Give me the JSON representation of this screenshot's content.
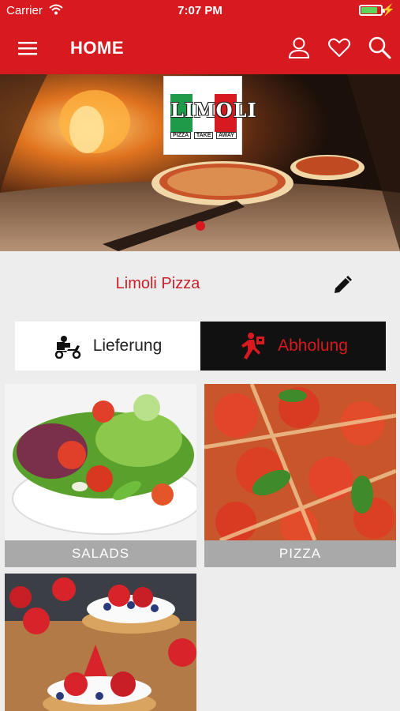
{
  "status_bar": {
    "carrier": "Carrier",
    "time": "7:07 PM"
  },
  "nav": {
    "title": "HOME",
    "icons": [
      "menu-icon",
      "user-icon",
      "heart-icon",
      "search-icon"
    ]
  },
  "hero": {
    "logo": {
      "brand": "LIMOLI",
      "tagline": [
        "PIZZA",
        "TAKE",
        "AWAY"
      ]
    },
    "carousel": {
      "active_index": 0,
      "count": 1
    }
  },
  "restaurant": {
    "name": "Limoli Pizza",
    "edit_icon": "pencil-icon"
  },
  "order_mode": {
    "options": [
      {
        "label": "Lieferung",
        "icon": "delivery-scooter-icon",
        "selected": false
      },
      {
        "label": "Abholung",
        "icon": "pickup-runner-icon",
        "selected": true
      }
    ]
  },
  "categories": [
    {
      "label": "SALADS"
    },
    {
      "label": "PIZZA"
    },
    {
      "label": ""
    }
  ],
  "colors": {
    "brand_red": "#d61a1f",
    "selected_bg": "#111111",
    "label_bg": "#a9a9a9"
  }
}
